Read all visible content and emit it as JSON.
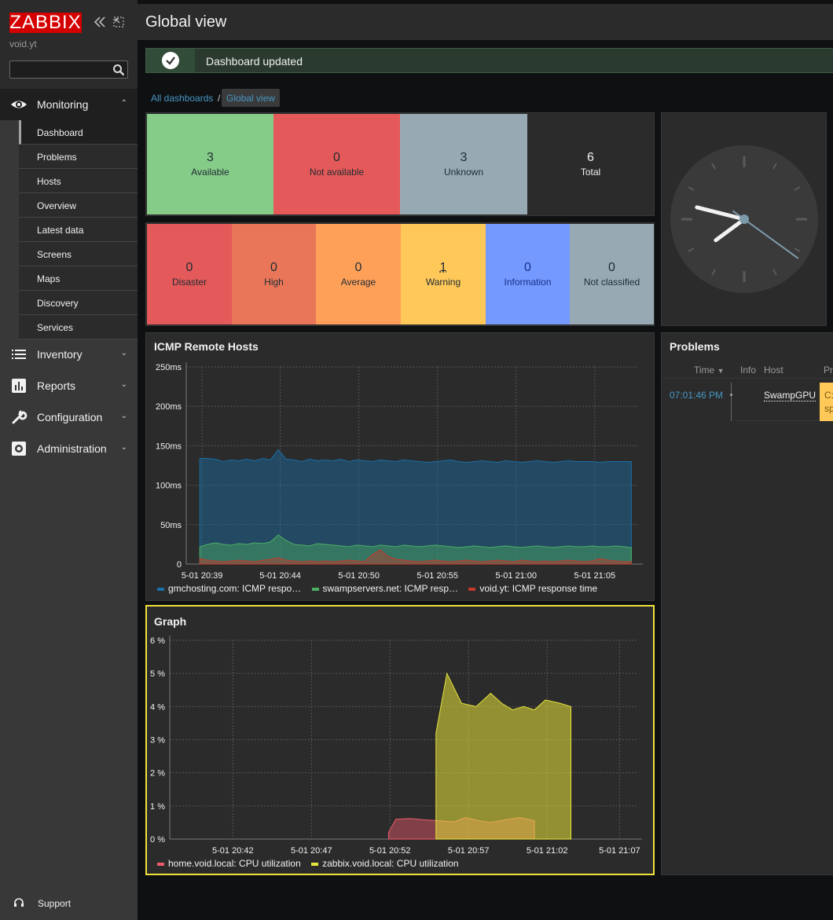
{
  "app": {
    "logo": "ZABBIX",
    "host": "void.yt"
  },
  "search": {
    "placeholder": ""
  },
  "menu": {
    "monitoring": {
      "label": "Monitoring",
      "items": [
        "Dashboard",
        "Problems",
        "Hosts",
        "Overview",
        "Latest data",
        "Screens",
        "Maps",
        "Discovery",
        "Services"
      ],
      "active": "Dashboard"
    },
    "inventory": "Inventory",
    "reports": "Reports",
    "configuration": "Configuration",
    "administration": "Administration",
    "support": "Support"
  },
  "page": {
    "title": "Global view",
    "message": "Dashboard updated"
  },
  "breadcrumb": {
    "root": "All dashboards",
    "separator": "/",
    "current": "Global view"
  },
  "host_availability": [
    {
      "num": "3",
      "label": "Available",
      "color": "#86cc89"
    },
    {
      "num": "0",
      "label": "Not available",
      "color": "#e45959"
    },
    {
      "num": "3",
      "label": "Unknown",
      "color": "#97aab3"
    },
    {
      "num": "6",
      "label": "Total",
      "color": "#2b2b2b"
    }
  ],
  "problems_by_severity": [
    {
      "num": "0",
      "label": "Disaster",
      "color": "#e45959"
    },
    {
      "num": "0",
      "label": "High",
      "color": "#e97659"
    },
    {
      "num": "0",
      "label": "Average",
      "color": "#ffa059"
    },
    {
      "num": "1",
      "label": "Warning",
      "color": "#ffc859"
    },
    {
      "num": "0",
      "label": "Information",
      "color": "#7499ff"
    },
    {
      "num": "0",
      "label": "Not classified",
      "color": "#97aab3"
    }
  ],
  "clock": {
    "hour": 7,
    "minute": 47,
    "second": 21
  },
  "problems": {
    "title": "Problems",
    "columns": {
      "time": "Time",
      "info": "Info",
      "host": "Host",
      "problem": "Pr"
    },
    "rows": [
      {
        "time": "07:01:46 PM",
        "host": "SwampGPU",
        "problem_line1": "C:",
        "problem_line2": "sp"
      }
    ]
  },
  "chart_data": [
    {
      "type": "area",
      "title": "ICMP Remote Hosts",
      "yticks": [
        "250ms",
        "200ms",
        "150ms",
        "100ms",
        "50ms",
        "0"
      ],
      "xticks": [
        "5-01 20:39",
        "5-01 20:44",
        "5-01 20:50",
        "5-01 20:55",
        "5-01 21:00",
        "5-01 21:05"
      ],
      "ylim": [
        0,
        250
      ],
      "series": [
        {
          "name": "gmchosting.com: ICMP respo…",
          "color": "#1a6fa8",
          "values": [
            134,
            134,
            133,
            130,
            132,
            131,
            133,
            131,
            134,
            132,
            145,
            133,
            132,
            130,
            133,
            131,
            132,
            131,
            133,
            130,
            132,
            131,
            130,
            132,
            131,
            130,
            132,
            131,
            130,
            129,
            130,
            131,
            132,
            130,
            129,
            130,
            131,
            130,
            129,
            131,
            130,
            129,
            130,
            131,
            130,
            129,
            130,
            131,
            130,
            130,
            130,
            129,
            130,
            130,
            130,
            130
          ]
        },
        {
          "name": "swampservers.net: ICMP resp…",
          "color": "#4cae63",
          "values": [
            22,
            25,
            27,
            25,
            24,
            26,
            25,
            27,
            26,
            28,
            37,
            30,
            25,
            24,
            23,
            26,
            25,
            24,
            23,
            22,
            24,
            23,
            22,
            24,
            23,
            22,
            24,
            23,
            22,
            23,
            24,
            23,
            22,
            21,
            22,
            23,
            22,
            21,
            22,
            23,
            22,
            21,
            22,
            23,
            22,
            21,
            22,
            23,
            22,
            22,
            23,
            22,
            22,
            23,
            22,
            21
          ]
        },
        {
          "name": "void.yt: ICMP response time",
          "color": "#c0392b",
          "values": [
            7,
            5,
            4,
            3,
            4,
            5,
            4,
            3,
            5,
            6,
            8,
            5,
            4,
            3,
            4,
            3,
            4,
            3,
            4,
            5,
            4,
            3,
            12,
            18,
            10,
            6,
            5,
            4,
            3,
            4,
            5,
            4,
            3,
            4,
            5,
            4,
            3,
            4,
            5,
            4,
            3,
            5,
            4,
            3,
            4,
            3,
            4,
            5,
            4,
            3,
            4,
            7,
            5,
            4,
            3,
            3
          ]
        }
      ]
    },
    {
      "type": "area",
      "title": "Graph",
      "yticks": [
        "6 %",
        "5 %",
        "4 %",
        "3 %",
        "2 %",
        "1 %",
        "0 %"
      ],
      "xticks": [
        "5-01 20:42",
        "5-01 20:47",
        "5-01 20:52",
        "5-01 20:57",
        "5-01 21:02",
        "5-01 21:07"
      ],
      "ylim": [
        0,
        6
      ],
      "series": [
        {
          "name": "home.void.local: CPU utilization",
          "color": "#ec5b6a",
          "x": [
            0.6,
            0.62,
            0.66,
            0.7,
            0.74,
            0.78,
            0.81,
            0.85,
            0.88,
            0.92,
            0.96,
            1.0
          ],
          "values": [
            0.2,
            0.6,
            0.62,
            0.58,
            0.55,
            0.52,
            0.65,
            0.55,
            0.5,
            0.58,
            0.65,
            0.55
          ]
        },
        {
          "name": "zabbix.void.local: CPU utilization",
          "color": "#e7e43b",
          "x": [
            0.73,
            0.76,
            0.8,
            0.84,
            0.88,
            0.91,
            0.94,
            0.97,
            1.0,
            1.03,
            1.07,
            1.1
          ],
          "values": [
            3.2,
            5.0,
            4.1,
            4.0,
            4.4,
            4.1,
            3.9,
            4.0,
            3.9,
            4.2,
            4.1,
            4.0
          ]
        }
      ]
    }
  ]
}
